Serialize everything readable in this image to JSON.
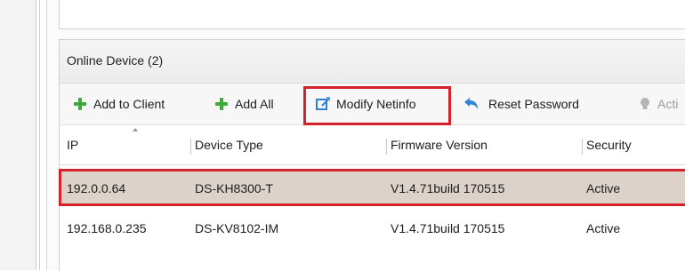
{
  "panel": {
    "title": "Online Device (2)"
  },
  "toolbar": {
    "add_to_client": "Add to Client",
    "add_all": "Add All",
    "modify_netinfo": "Modify Netinfo",
    "reset_password": "Reset Password",
    "activate_partial": "Acti"
  },
  "table": {
    "columns": [
      "IP",
      "Device Type",
      "Firmware Version",
      "Security"
    ],
    "rows": [
      {
        "ip": "192.0.0.64",
        "device_type": "DS-KH8300-T",
        "firmware": "V1.4.71build 170515",
        "security": "Active",
        "selected": true
      },
      {
        "ip": "192.168.0.235",
        "device_type": "DS-KV8102-IM",
        "firmware": "V1.4.71build 170515",
        "security": "Active",
        "selected": false
      }
    ]
  },
  "colors": {
    "highlight": "#d4222b",
    "selected_row": "#dcd2c9",
    "add_green": "#3ea83a",
    "modify_blue": "#2f7fd6",
    "reset_blue": "#2f86d9"
  },
  "icons": [
    "plus-icon",
    "modify-icon",
    "reset-icon",
    "bulb-icon",
    "sort-ascending-icon"
  ]
}
